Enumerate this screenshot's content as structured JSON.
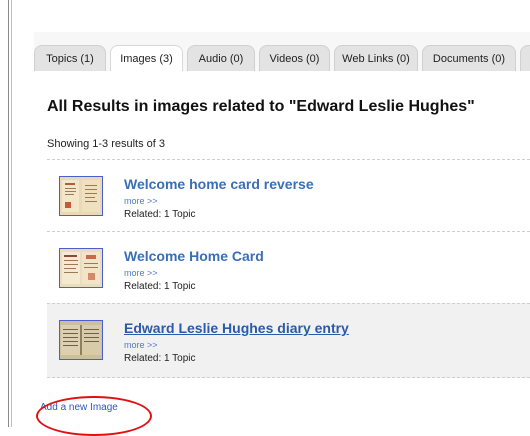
{
  "tabs": [
    {
      "label": "Topics (1)",
      "active": false
    },
    {
      "label": "Images (3)",
      "active": true
    },
    {
      "label": "Audio (0)",
      "active": false
    },
    {
      "label": "Videos (0)",
      "active": false
    },
    {
      "label": "Web Links (0)",
      "active": false
    },
    {
      "label": "Documents (0)",
      "active": false
    }
  ],
  "heading": "All Results in images related to \"Edward Leslie Hughes\"",
  "showing": "Showing 1-3 results of 3",
  "results": [
    {
      "title": "Welcome home card reverse",
      "more": "more >>",
      "related": "Related: 1 Topic"
    },
    {
      "title": "Welcome Home Card",
      "more": "more >>",
      "related": "Related: 1 Topic"
    },
    {
      "title": "Edward Leslie Hughes diary entry",
      "more": "more >>",
      "related": "Related: 1 Topic"
    }
  ],
  "add_link": "Add a new Image",
  "colors": {
    "link": "#3a6fb8",
    "highlight": "#e01010",
    "thumb_border": "#4a5fcf"
  }
}
